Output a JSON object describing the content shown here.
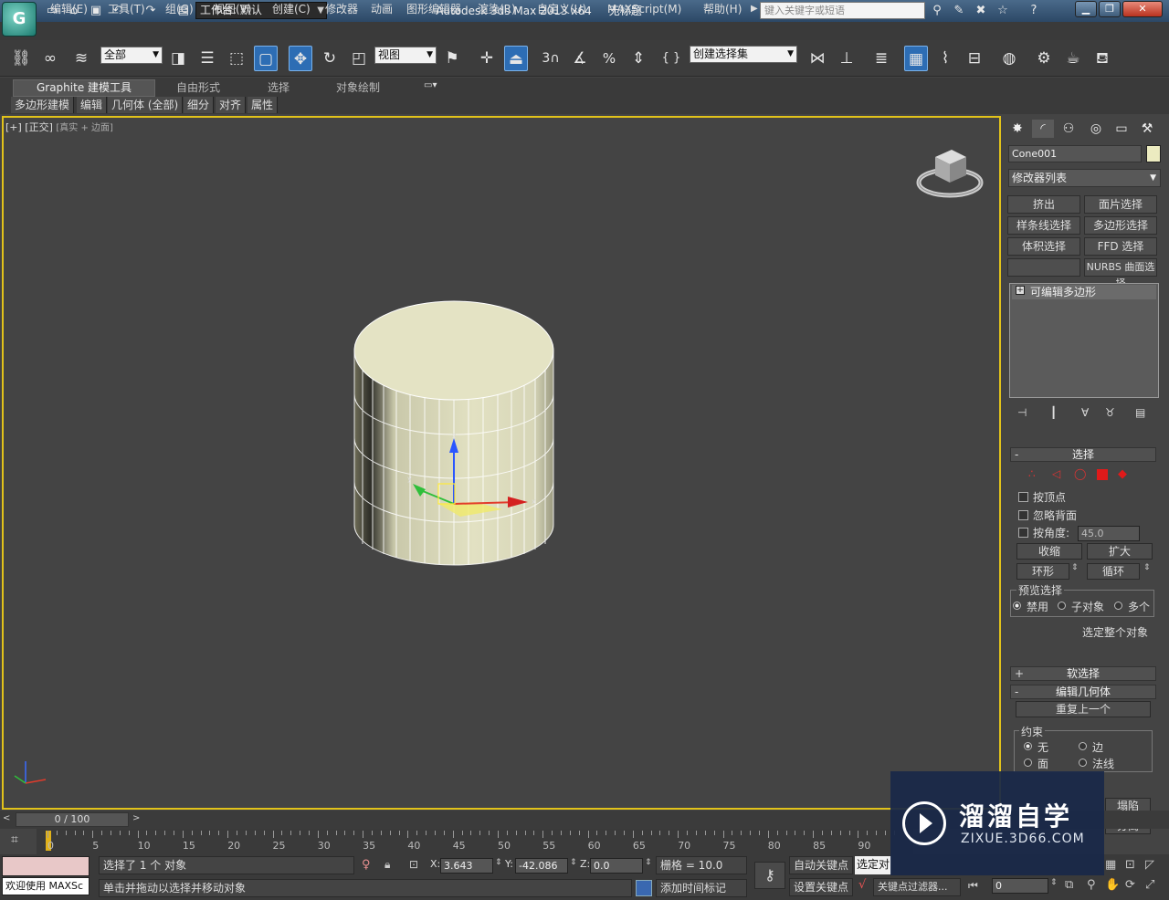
{
  "title_bar": {
    "workspace_label": "工作台: 默认",
    "app_title": "Autodesk 3ds Max  2013 x64",
    "file_title": "无标题",
    "search_placeholder": "键入关键字或短语"
  },
  "menu": [
    "编辑(E)",
    "工具(T)",
    "组(G)",
    "视图(V)",
    "创建(C)",
    "修改器",
    "动画",
    "图形编辑器",
    "渲染(R)",
    "自定义(U)",
    "MAXScript(M)",
    "帮助(H)"
  ],
  "toolbar": {
    "selection_filter": "全部",
    "reference_coord": "视图",
    "snap_angle_label": "3",
    "named_selection_placeholder": "创建选择集"
  },
  "ribbon": {
    "tabs": [
      "Graphite 建模工具",
      "自由形式",
      "选择",
      "对象绘制"
    ],
    "subtabs": [
      "多边形建模",
      "编辑",
      "几何体 (全部)",
      "细分",
      "对齐",
      "属性"
    ]
  },
  "viewport": {
    "label_bracket": "[+] [正交]",
    "label_shading": "[真实 + 边面]"
  },
  "command_panel": {
    "object_name": "Cone001",
    "object_color": "#ecebc0",
    "modifier_list": "修改器列表",
    "modifier_buttons": [
      "挤出",
      "面片选择",
      "样条线选择",
      "多边形选择",
      "体积选择",
      "FFD 选择",
      "",
      "NURBS 曲面选择"
    ],
    "stack_item": "可编辑多边形",
    "selection_rollout": {
      "title": "选择",
      "by_vertex": "按顶点",
      "ignore_backfacing": "忽略背面",
      "by_angle": "按角度:",
      "angle_value": "45.0",
      "shrink": "收缩",
      "grow": "扩大",
      "ring": "环形",
      "loop": "循环",
      "preview_selection": "预览选择",
      "preview_off": "禁用",
      "preview_subobj": "子对象",
      "preview_multi": "多个",
      "whole_object": "选定整个对象"
    },
    "soft_selection_title": "软选择",
    "edit_geometry": {
      "title": "编辑几何体",
      "repeat_last": "重复上一个",
      "constraints": "约束",
      "none": "无",
      "edge": "边",
      "face": "面",
      "normal": "法线",
      "collapse": "塌陷",
      "detach": "分离"
    }
  },
  "timeline": {
    "slider": "0 / 100",
    "ticks": [
      "0",
      "5",
      "10",
      "15",
      "20",
      "25",
      "30",
      "35",
      "40",
      "45",
      "50",
      "55",
      "60",
      "65",
      "70",
      "75",
      "80",
      "85",
      "90"
    ]
  },
  "status": {
    "welcome": "欢迎使用 MAXSc",
    "selected": "选择了 1 个 对象",
    "hint": "单击并拖动以选择并移动对象",
    "x_label": "X:",
    "x_value": "3.643",
    "y_label": "Y:",
    "y_value": "-42.086",
    "z_label": "Z:",
    "z_value": "0.0",
    "grid": "栅格 = 10.0",
    "add_time_tag": "添加时间标记",
    "auto_key": "自动关键点",
    "set_key": "设置关键点",
    "selected_dropdown": "选定对",
    "key_filters": "关键点过滤器...",
    "frame_value": "0"
  },
  "watermark": {
    "name": "溜溜自学",
    "url": "ZIXUE.3D66.COM"
  }
}
